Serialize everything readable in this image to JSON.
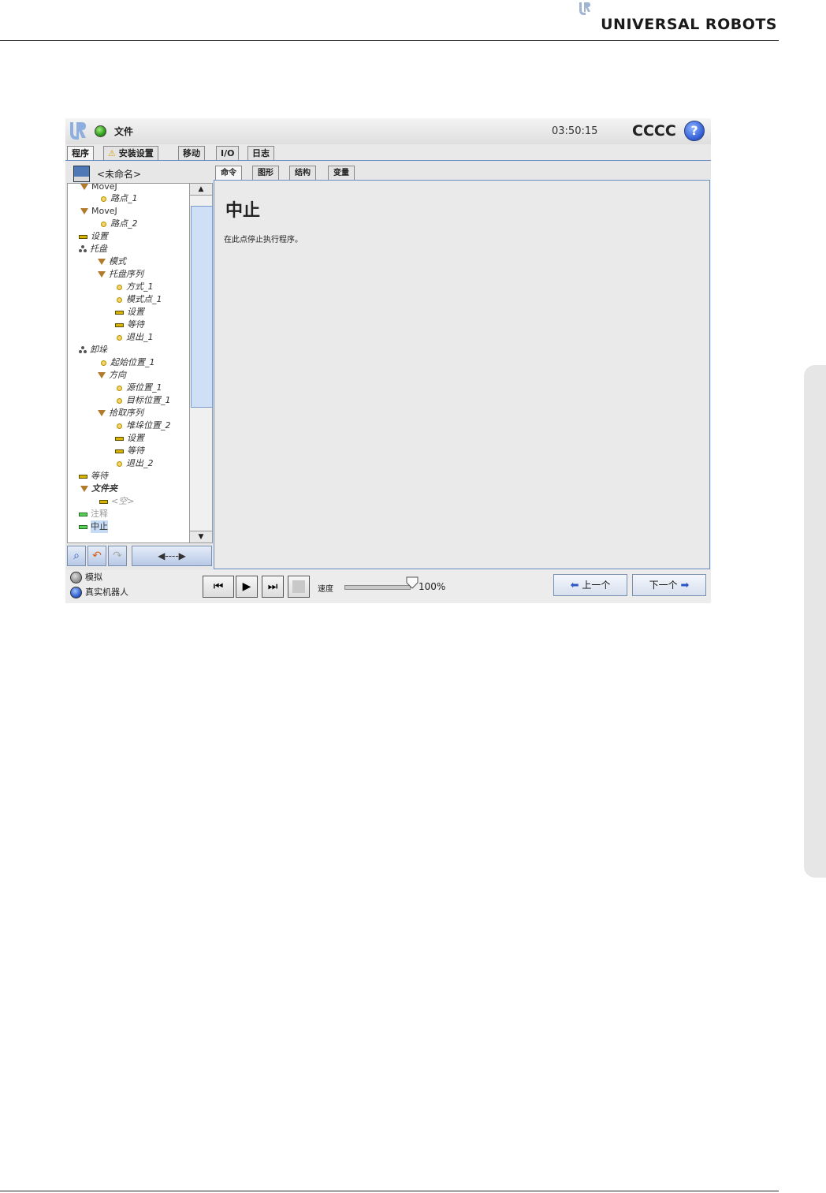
{
  "page": {
    "brand": "UNIVERSAL ROBOTS"
  },
  "titlebar": {
    "file_label": "文件",
    "time": "03:50:15",
    "user": "CCCC",
    "help": "?"
  },
  "main_tabs": [
    "程序",
    "安装设置",
    "移动",
    "I/O",
    "日志"
  ],
  "program_name": "<未命名>",
  "sub_tabs": [
    "命令",
    "图形",
    "结构",
    "变量"
  ],
  "tree": [
    "MoveJ",
    "路点_1",
    "MoveJ",
    "路点_2",
    "设置",
    "托盘",
    "模式",
    "托盘序列",
    "方式_1",
    "模式点_1",
    "设置",
    "等待",
    "退出_1",
    "卸垛",
    "起始位置_1",
    "方向",
    "源位置_1",
    "目标位置_1",
    "拾取序列",
    "堆垛位置_2",
    "设置",
    "等待",
    "退出_2",
    "等待",
    "文件夹",
    "<空>",
    "注释",
    "中止"
  ],
  "content": {
    "title": "中止",
    "description": "在此点停止执行程序。"
  },
  "tree_tools": {
    "move_label": "◀----▶"
  },
  "bottom": {
    "mode_simulation": "模拟",
    "mode_real": "真实机器人",
    "speed_label": "速度",
    "speed_value": "100%",
    "speed_fraction": 1.0,
    "prev_label": "上一个",
    "next_label": "下一个"
  },
  "colors": {
    "accent_blue": "#6a8fc4",
    "status_green": "#2e9b1a",
    "icon_orange": "#b27a2d"
  }
}
